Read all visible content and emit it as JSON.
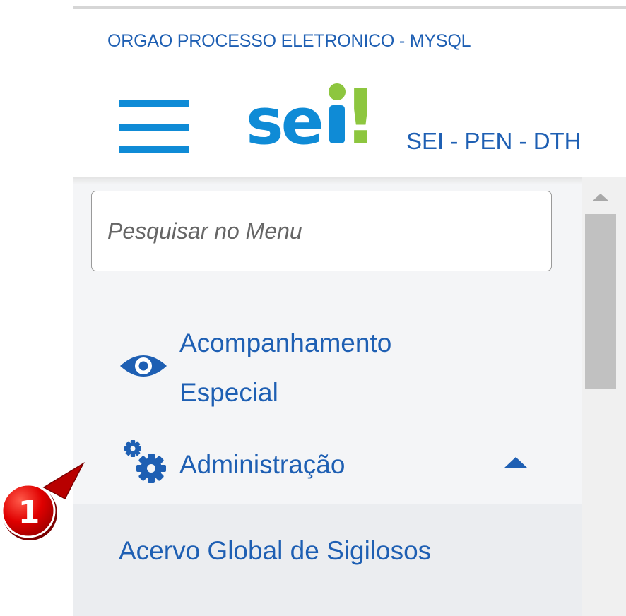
{
  "header": {
    "org_name": "ORGAO PROCESSO ELETRONICO - MYSQL",
    "system_name": "SEI - PEN - DTH",
    "logo": {
      "text_prefix": "se",
      "text_suffix": "!",
      "blue": "#0f8bd6",
      "green": "#8dc63f"
    }
  },
  "search": {
    "placeholder": "Pesquisar no Menu",
    "value": ""
  },
  "menu": {
    "items": [
      {
        "label_line1": "Acompanhamento",
        "label_line2": "Especial",
        "icon": "eye-icon"
      },
      {
        "label": "Administração",
        "icon": "gears-icon",
        "expanded_icon": "caret-up-icon"
      }
    ],
    "submenu": [
      {
        "label": "Acervo Global de Sigilosos"
      }
    ]
  },
  "callout": {
    "number": "1",
    "color": "#e00000"
  },
  "colors": {
    "link_blue": "#1e5fb3",
    "sidebar_bg": "#f4f5f7",
    "submenu_bg": "#ebedf0"
  }
}
